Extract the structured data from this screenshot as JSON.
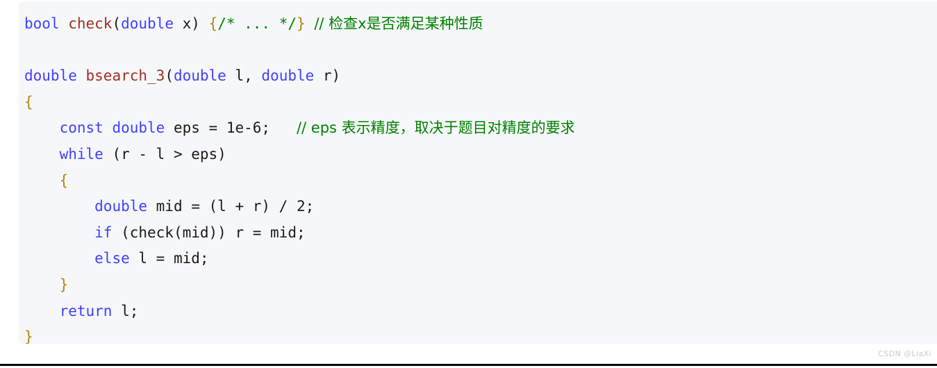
{
  "code_block": {
    "language": "cpp",
    "background_color": "#f6f7f9",
    "colors": {
      "keyword": "#4040ff",
      "function": "#a03020",
      "comment": "#008000",
      "brace": "#b8860b",
      "plain": "#1a1a1a",
      "page_background": "#ffffff",
      "watermark": "#c9ccd1"
    },
    "lines": [
      {
        "index": 1,
        "text": "bool check(double x) {/* ... */} // 检查x是否满足某种性质",
        "tokens": [
          {
            "t": "bool",
            "c": "kw"
          },
          {
            "t": " ",
            "c": "plain"
          },
          {
            "t": "check",
            "c": "fn"
          },
          {
            "t": "(",
            "c": "punct"
          },
          {
            "t": "double",
            "c": "kw"
          },
          {
            "t": " x) ",
            "c": "plain"
          },
          {
            "t": "{",
            "c": "brace"
          },
          {
            "t": "/* ... */",
            "c": "cmt"
          },
          {
            "t": "}",
            "c": "brace"
          },
          {
            "t": " ",
            "c": "plain"
          },
          {
            "t": "// 检查x是否满足某种性质",
            "c": "cmt"
          }
        ]
      },
      {
        "index": 2,
        "text": "",
        "tokens": []
      },
      {
        "index": 3,
        "text": "double bsearch_3(double l, double r)",
        "tokens": [
          {
            "t": "double",
            "c": "kw"
          },
          {
            "t": " ",
            "c": "plain"
          },
          {
            "t": "bsearch_3",
            "c": "fn"
          },
          {
            "t": "(",
            "c": "punct"
          },
          {
            "t": "double",
            "c": "kw"
          },
          {
            "t": " l, ",
            "c": "plain"
          },
          {
            "t": "double",
            "c": "kw"
          },
          {
            "t": " r)",
            "c": "plain"
          }
        ]
      },
      {
        "index": 4,
        "text": "{",
        "tokens": [
          {
            "t": "{",
            "c": "brace"
          }
        ]
      },
      {
        "index": 5,
        "text": "    const double eps = 1e-6;   // eps 表示精度，取决于题目对精度的要求",
        "tokens": [
          {
            "t": "    ",
            "c": "plain"
          },
          {
            "t": "const",
            "c": "kw"
          },
          {
            "t": " ",
            "c": "plain"
          },
          {
            "t": "double",
            "c": "kw"
          },
          {
            "t": " eps = 1e-6;   ",
            "c": "plain"
          },
          {
            "t": "// eps 表示精度，取决于题目对精度的要求",
            "c": "cmt"
          }
        ]
      },
      {
        "index": 6,
        "text": "    while (r - l > eps)",
        "tokens": [
          {
            "t": "    ",
            "c": "plain"
          },
          {
            "t": "while",
            "c": "kw"
          },
          {
            "t": " (r - l > eps)",
            "c": "plain"
          }
        ]
      },
      {
        "index": 7,
        "text": "    {",
        "tokens": [
          {
            "t": "    ",
            "c": "plain"
          },
          {
            "t": "{",
            "c": "brace"
          }
        ]
      },
      {
        "index": 8,
        "text": "        double mid = (l + r) / 2;",
        "tokens": [
          {
            "t": "        ",
            "c": "plain"
          },
          {
            "t": "double",
            "c": "kw"
          },
          {
            "t": " mid = (l + r) / 2;",
            "c": "plain"
          }
        ]
      },
      {
        "index": 9,
        "text": "        if (check(mid)) r = mid;",
        "tokens": [
          {
            "t": "        ",
            "c": "plain"
          },
          {
            "t": "if",
            "c": "kw"
          },
          {
            "t": " (check(mid)) r = mid;",
            "c": "plain"
          }
        ]
      },
      {
        "index": 10,
        "text": "        else l = mid;",
        "tokens": [
          {
            "t": "        ",
            "c": "plain"
          },
          {
            "t": "else",
            "c": "kw"
          },
          {
            "t": " l = mid;",
            "c": "plain"
          }
        ]
      },
      {
        "index": 11,
        "text": "    }",
        "tokens": [
          {
            "t": "    ",
            "c": "plain"
          },
          {
            "t": "}",
            "c": "brace"
          }
        ]
      },
      {
        "index": 12,
        "text": "    return l;",
        "tokens": [
          {
            "t": "    ",
            "c": "plain"
          },
          {
            "t": "return",
            "c": "kw"
          },
          {
            "t": " l;",
            "c": "plain"
          }
        ]
      },
      {
        "index": 13,
        "text": "}",
        "tokens": [
          {
            "t": "}",
            "c": "brace"
          }
        ]
      }
    ]
  },
  "watermark": {
    "label": "CSDN @LiaXi"
  }
}
